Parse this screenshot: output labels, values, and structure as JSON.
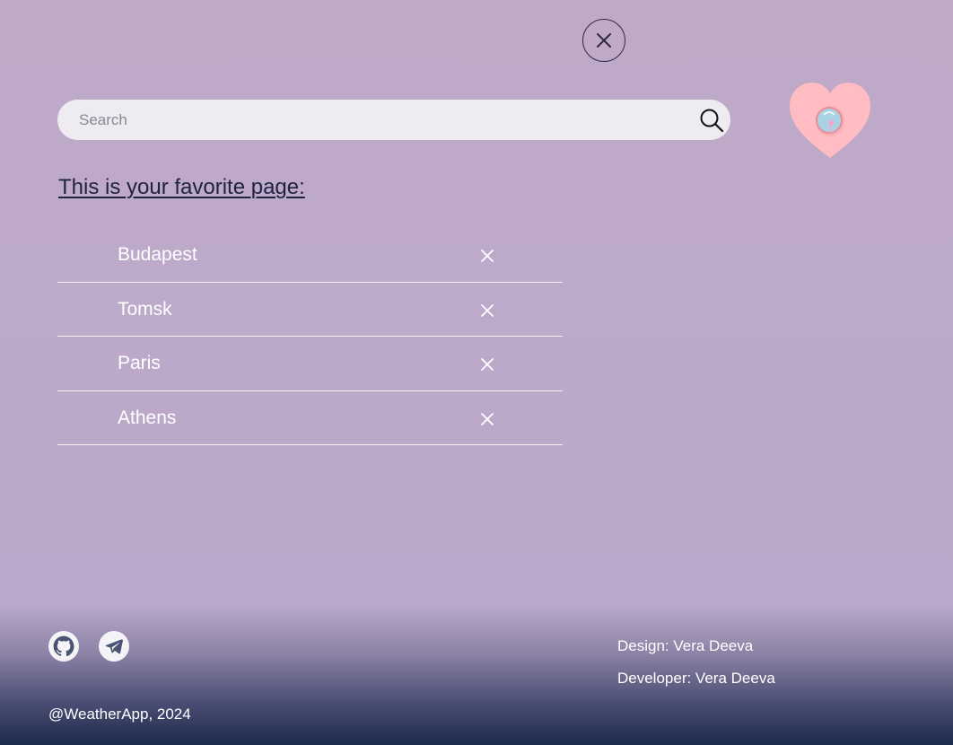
{
  "top": {
    "close_icon": "close-icon"
  },
  "search": {
    "placeholder": "Search",
    "value": "",
    "icon": "search-icon"
  },
  "heart_badge": {
    "icon": "heart-icon",
    "color": "#ffbcc2"
  },
  "favorites": {
    "heading": "This is your favorite page:",
    "items": [
      {
        "label": "Budapest"
      },
      {
        "label": "Tomsk"
      },
      {
        "label": "Paris"
      },
      {
        "label": "Athens"
      }
    ],
    "remove_icon": "close-icon"
  },
  "footer": {
    "social": [
      {
        "icon": "github-icon"
      },
      {
        "icon": "telegram-icon"
      }
    ],
    "copyright": "@WeatherApp, 2024",
    "design_credit": "Design: Vera Deeva",
    "developer_credit": "Developer: Vera Deeva"
  },
  "colors": {
    "background": "#bda9c6",
    "search_bg": "#eeecf1",
    "heading": "#1f2240",
    "footer_bottom": "#1c2a4b"
  }
}
